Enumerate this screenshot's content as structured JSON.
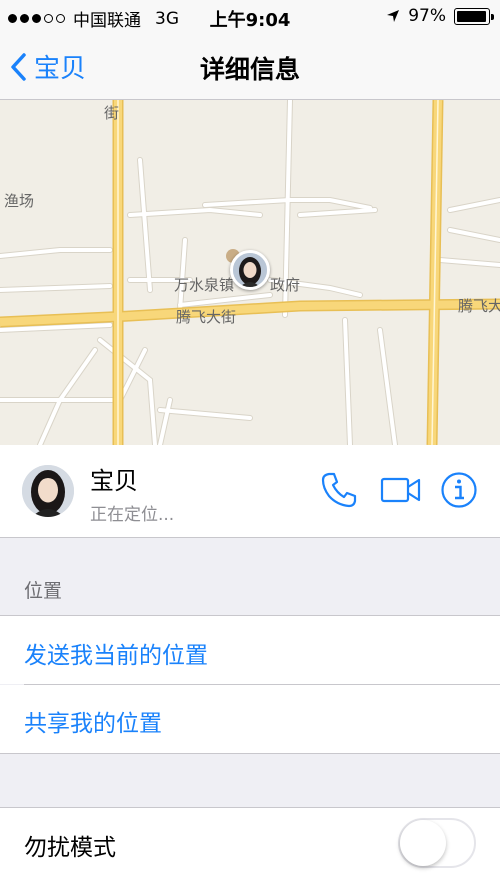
{
  "status_bar": {
    "carrier": "中国联通",
    "network": "3G",
    "time": "上午9:04",
    "battery_percent": "97%",
    "battery_level": 0.97,
    "signal_bars": 3,
    "signal_total": 5
  },
  "nav": {
    "back_label": "宝贝",
    "title": "详细信息"
  },
  "map": {
    "labels": {
      "fishery": "渔场",
      "water_town": "万水泉镇",
      "government": "政府",
      "street_1": "腾飞大街",
      "street_2": "腾飞大",
      "vertical": "街"
    },
    "colors": {
      "background": "#f1eee6",
      "major_road": "#f8d77a",
      "minor_road": "#ffffff"
    }
  },
  "contact": {
    "name": "宝贝",
    "status": "正在定位...",
    "actions": [
      "phone-icon",
      "video-icon",
      "info-icon"
    ]
  },
  "location_section": {
    "header": "位置",
    "send_current": "发送我当前的位置",
    "share": "共享我的位置"
  },
  "dnd": {
    "label": "勿扰模式",
    "enabled": false
  },
  "colors": {
    "accent": "#1a82fb",
    "separator": "#c8c7cc",
    "grouped_background": "#efeff4"
  }
}
